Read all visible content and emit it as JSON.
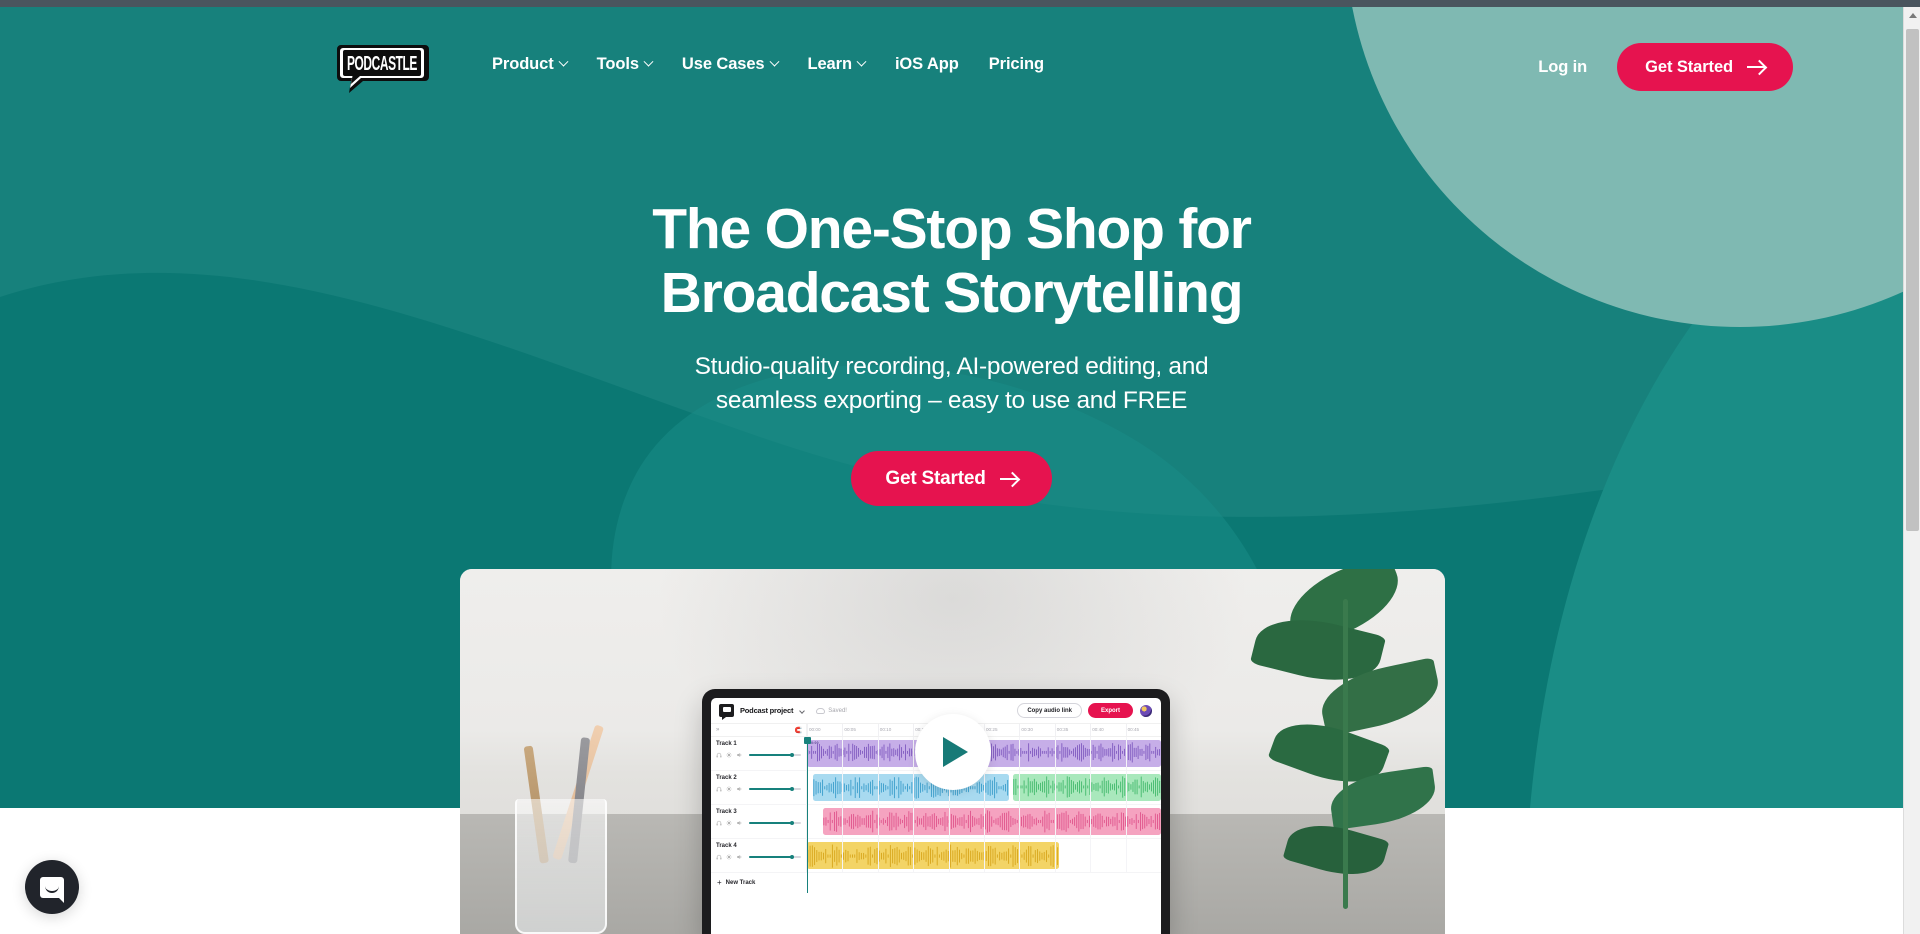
{
  "brand": {
    "name": "PODCASTLE",
    "accent_pink": "#E6134F",
    "teal": "#17817c",
    "teal_dark": "#0b7873",
    "teal_light": "#7fb9b2"
  },
  "nav": {
    "logo_alt": "Podcastle",
    "links": [
      {
        "label": "Product",
        "has_dropdown": true
      },
      {
        "label": "Tools",
        "has_dropdown": true
      },
      {
        "label": "Use Cases",
        "has_dropdown": true
      },
      {
        "label": "Learn",
        "has_dropdown": true
      },
      {
        "label": "iOS App",
        "has_dropdown": false
      },
      {
        "label": "Pricing",
        "has_dropdown": false
      }
    ],
    "login_label": "Log in",
    "cta_label": "Get Started"
  },
  "hero": {
    "title": "The One-Stop Shop for\nBroadcast Storytelling",
    "subtitle": "Studio-quality recording, AI-powered editing, and\nseamless exporting – easy to use and FREE",
    "cta_label": "Get Started"
  },
  "editor": {
    "project_name": "Podcast project",
    "save_status": "Saved!",
    "copy_link_label": "Copy audio link",
    "export_label": "Export",
    "new_track_label": "New Track",
    "timeline_labels": [
      "00:00",
      "00:05",
      "00:10",
      "00:15",
      "00:20",
      "00:25",
      "00:30",
      "00:35",
      "00:40",
      "00:45"
    ],
    "clip_badge": "00:00",
    "tracks": [
      {
        "name": "Track 1",
        "color": "#c6aee8",
        "wave": "#7b55bd",
        "volume": 80
      },
      {
        "name": "Track 2",
        "color": "#a8daf0",
        "wave": "#3e9fcc",
        "volume": 80
      },
      {
        "name": "Track 3",
        "color": "#f5a3c0",
        "wave": "#e0568d",
        "volume": 80
      },
      {
        "name": "Track 4",
        "color": "#f3d466",
        "wave": "#d9a81f",
        "volume": 80
      }
    ],
    "track2_second_clip_color": "#a9e8bc",
    "track2_second_clip_wave": "#40b86a",
    "play_button_label": "Play"
  },
  "widgets": {
    "intercom_label": "Open Intercom Messenger"
  }
}
